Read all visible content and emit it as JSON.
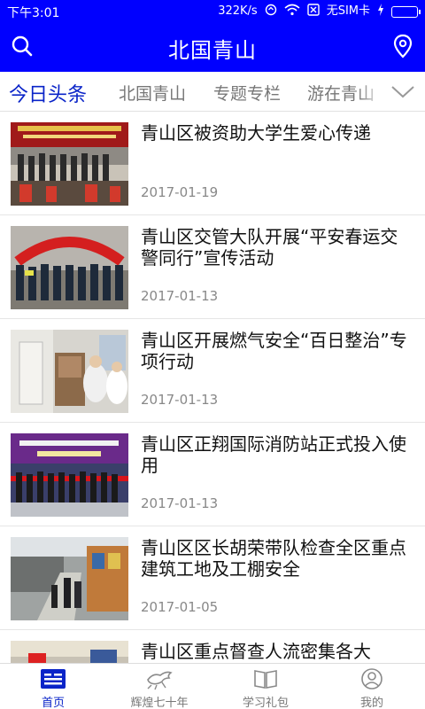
{
  "status_bar": {
    "time": "下午3:01",
    "speed": "322K/s",
    "sim": "无SIM卡"
  },
  "header": {
    "title": "北国青山"
  },
  "tabs": [
    {
      "label": "今日头条",
      "active": true
    },
    {
      "label": "北国青山",
      "active": false
    },
    {
      "label": "专题专栏",
      "active": false
    },
    {
      "label": "游在青山",
      "active": false
    }
  ],
  "news": [
    {
      "title": "青山区被资助大学生爱心传递",
      "date": "2017-01-19"
    },
    {
      "title": "青山区交管大队开展“平安春运交警同行”宣传活动",
      "date": "2017-01-13"
    },
    {
      "title": "青山区开展燃气安全“百日整治”专项行动",
      "date": "2017-01-13"
    },
    {
      "title": "青山区正翔国际消防站正式投入使用",
      "date": "2017-01-13"
    },
    {
      "title": "青山区区长胡荣带队检查全区重点建筑工地及工棚安全",
      "date": "2017-01-05"
    },
    {
      "title": "青山区重点督查人流密集各大",
      "date": ""
    }
  ],
  "bottom_nav": [
    {
      "label": "首页",
      "active": true
    },
    {
      "label": "辉煌七十年",
      "active": false
    },
    {
      "label": "学习礼包",
      "active": false
    },
    {
      "label": "我的",
      "active": false
    }
  ],
  "colors": {
    "brand_blue": "#0000ff",
    "active_tab": "#0a24c8"
  }
}
